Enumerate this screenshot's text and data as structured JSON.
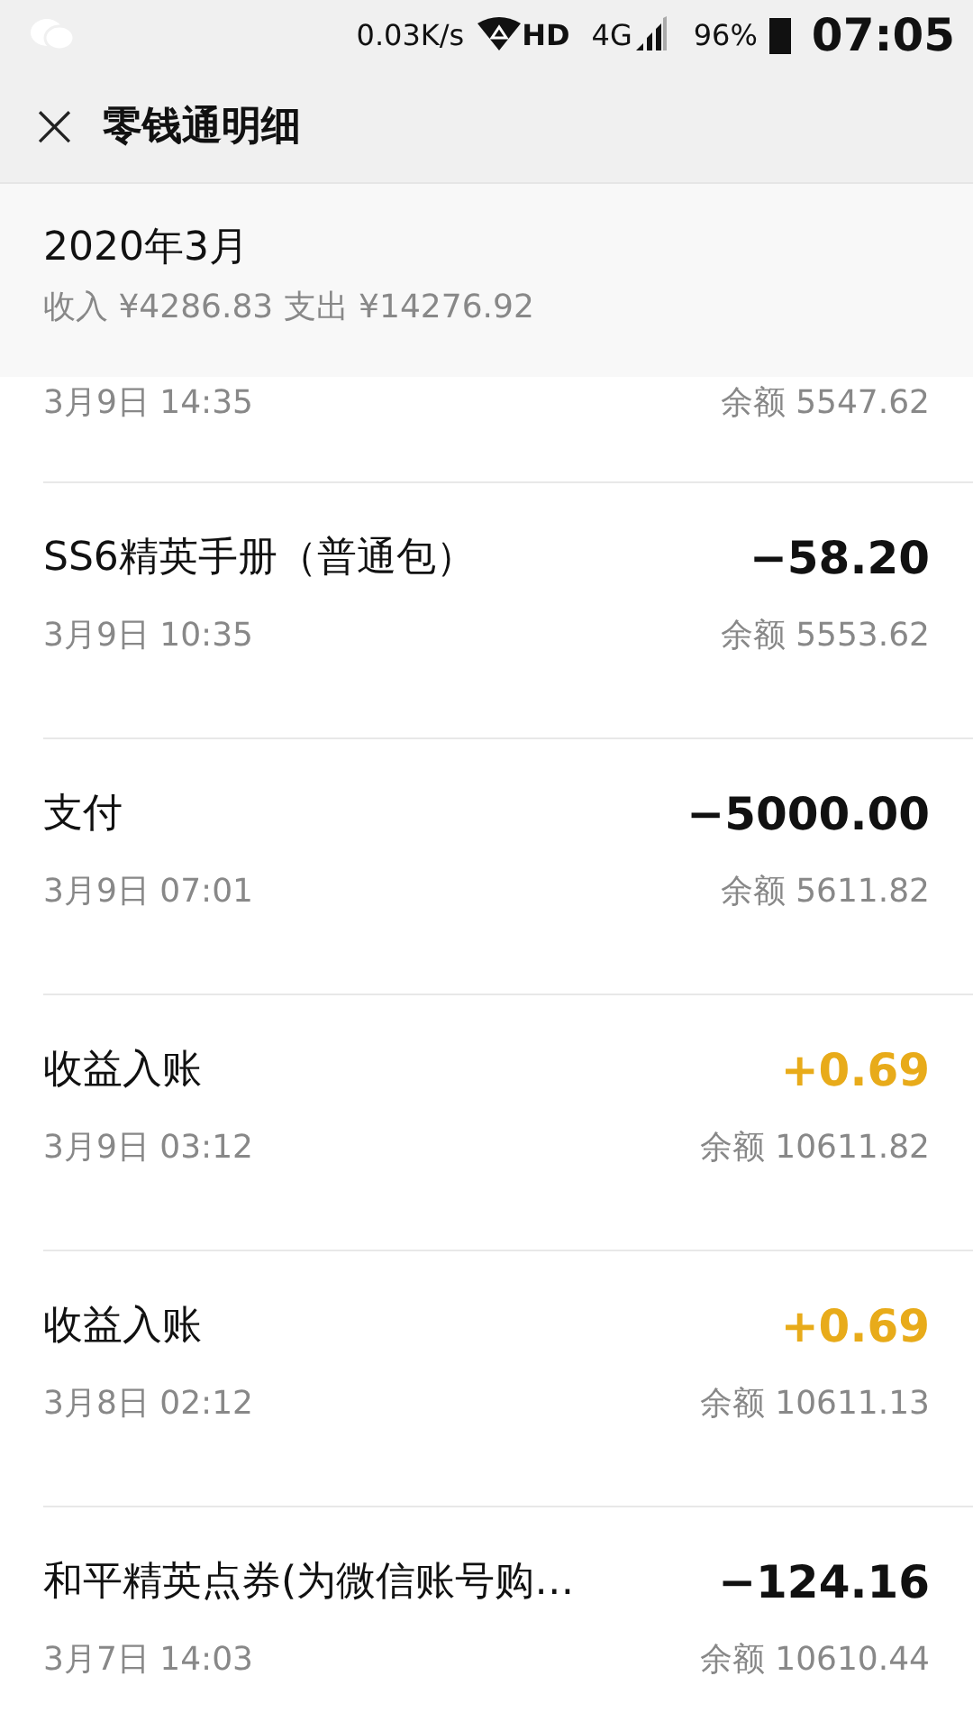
{
  "status_bar": {
    "speed": "0.03K/s",
    "hd": "HD",
    "network": "4G",
    "battery": "96%",
    "time": "07:05"
  },
  "header": {
    "close": "×",
    "title": "零钱通明细"
  },
  "month": {
    "title": "2020年3月",
    "summary": "收入 ¥4286.83 支出 ¥14276.92"
  },
  "transactions": [
    {
      "date": "3月9日 14:35",
      "balance": "余额 5547.62"
    },
    {
      "title": "SS6精英手册（普通包）",
      "amount": "−58.20",
      "kind": "expense",
      "date": "3月9日 10:35",
      "balance": "余额 5553.62"
    },
    {
      "title": "支付",
      "amount": "−5000.00",
      "kind": "expense",
      "date": "3月9日 07:01",
      "balance": "余额 5611.82"
    },
    {
      "title": "收益入账",
      "amount": "+0.69",
      "kind": "income",
      "date": "3月9日 03:12",
      "balance": "余额 10611.82"
    },
    {
      "title": "收益入账",
      "amount": "+0.69",
      "kind": "income",
      "date": "3月8日 02:12",
      "balance": "余额 10611.13"
    },
    {
      "title": "和平精英点券(为微信账号购…",
      "amount": "−124.16",
      "kind": "expense",
      "date": "3月7日 14:03",
      "balance": "余额 10610.44"
    }
  ]
}
